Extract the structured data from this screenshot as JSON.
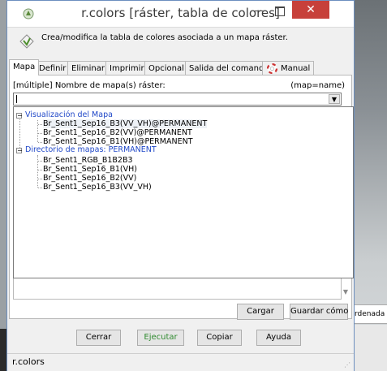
{
  "window": {
    "title": "r.colors [ráster, tabla de colores]",
    "minimize": "—",
    "close": "✕"
  },
  "description": "Crea/modifica la tabla de colores asociada a un mapa ráster.",
  "tabs": [
    {
      "label": "Mapa",
      "active": true
    },
    {
      "label": "Definir"
    },
    {
      "label": "Eliminar"
    },
    {
      "label": "Imprimir"
    },
    {
      "label": "Opcional"
    },
    {
      "label": "Salida del comando"
    },
    {
      "label": "Manual"
    }
  ],
  "field": {
    "label": "[múltiple] Nombre de mapa(s) ráster:",
    "key": "(map=name)",
    "value": ""
  },
  "tree": {
    "groups": [
      {
        "label": "Visualización del Mapa",
        "items": [
          "Br_Sent1_Sep16_B3(VV_VH)@PERMANENT",
          "Br_Sent1_Sep16_B2(VV)@PERMANENT",
          "Br_Sent1_Sep16_B1(VH)@PERMANENT"
        ]
      },
      {
        "label": "Directorio de mapas: PERMANENT",
        "items": [
          "Br_Sent1_RGB_B1B2B3",
          "Br_Sent1_Sep16_B1(VH)",
          "Br_Sent1_Sep16_B2(VV)",
          "Br_Sent1_Sep16_B3(VV_VH)"
        ]
      }
    ]
  },
  "buttons": {
    "cargar": "Cargar",
    "guardar": "Guardar cómo",
    "cerrar": "Cerrar",
    "ejecutar": "Ejecutar",
    "copiar": "Copiar",
    "ayuda": "Ayuda"
  },
  "status": "r.colors",
  "background": {
    "snippet": "rdenada"
  }
}
